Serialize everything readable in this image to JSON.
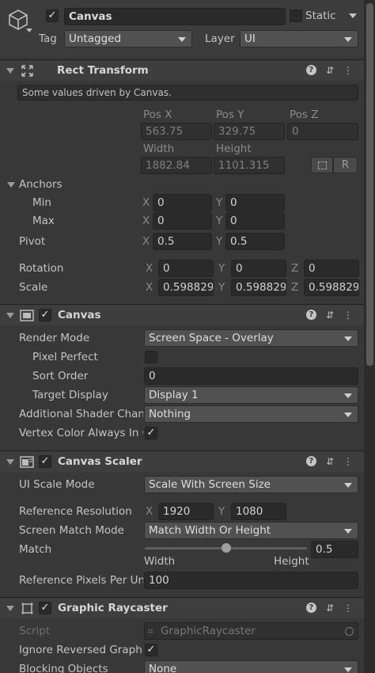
{
  "object": {
    "name": "Canvas",
    "static_label": "Static",
    "tag_label": "Tag",
    "tag_value": "Untagged",
    "layer_label": "Layer",
    "layer_value": "UI"
  },
  "rect_transform": {
    "title": "Rect Transform",
    "note": "Some values driven by Canvas.",
    "pos_x_label": "Pos X",
    "pos_y_label": "Pos Y",
    "pos_z_label": "Pos Z",
    "pos_x": "563.75",
    "pos_y": "329.75",
    "pos_z": "0",
    "width_label": "Width",
    "height_label": "Height",
    "width": "1882.84",
    "height": "1101.315",
    "r_button": "R",
    "anchors_label": "Anchors",
    "min_label": "Min",
    "max_label": "Max",
    "min_x": "0",
    "min_y": "0",
    "max_x": "0",
    "max_y": "0",
    "pivot_label": "Pivot",
    "pivot_x": "0.5",
    "pivot_y": "0.5",
    "rotation_label": "Rotation",
    "rot_x": "0",
    "rot_y": "0",
    "rot_z": "0",
    "scale_label": "Scale",
    "scale_x": "0.598829",
    "scale_y": "0.598829",
    "scale_z": "0.598829",
    "x": "X",
    "y": "Y",
    "z": "Z"
  },
  "canvas": {
    "title": "Canvas",
    "render_mode_label": "Render Mode",
    "render_mode": "Screen Space - Overlay",
    "pixel_perfect_label": "Pixel Perfect",
    "sort_order_label": "Sort Order",
    "sort_order": "0",
    "target_display_label": "Target Display",
    "target_display": "Display 1",
    "shader_channels_label": "Additional Shader Channels",
    "shader_channels": "Nothing",
    "vertex_color_label": "Vertex Color Always In Gamma Color Space"
  },
  "canvas_scaler": {
    "title": "Canvas Scaler",
    "ui_scale_mode_label": "UI Scale Mode",
    "ui_scale_mode": "Scale With Screen Size",
    "ref_res_label": "Reference Resolution",
    "ref_x": "1920",
    "ref_y": "1080",
    "screen_match_label": "Screen Match Mode",
    "screen_match": "Match Width Or Height",
    "match_label": "Match",
    "match_value": "0.5",
    "match_fraction": 0.5,
    "width_label": "Width",
    "height_label": "Height",
    "ref_ppu_label": "Reference Pixels Per Unit",
    "ref_ppu": "100"
  },
  "raycaster": {
    "title": "Graphic Raycaster",
    "script_label": "Script",
    "script_value": "GraphicRaycaster",
    "ignore_reversed_label": "Ignore Reversed Graphics",
    "blocking_label": "Blocking Objects",
    "blocking_value": "None"
  },
  "icons": {
    "object": "cube-icon",
    "rect_transform": "rect-transform-icon",
    "canvas": "canvas-icon",
    "scaler": "canvas-scaler-icon",
    "raycaster": "graphic-raycaster-icon",
    "help": "help-icon",
    "preset": "preset-icon",
    "menu": "kebab-menu-icon"
  }
}
